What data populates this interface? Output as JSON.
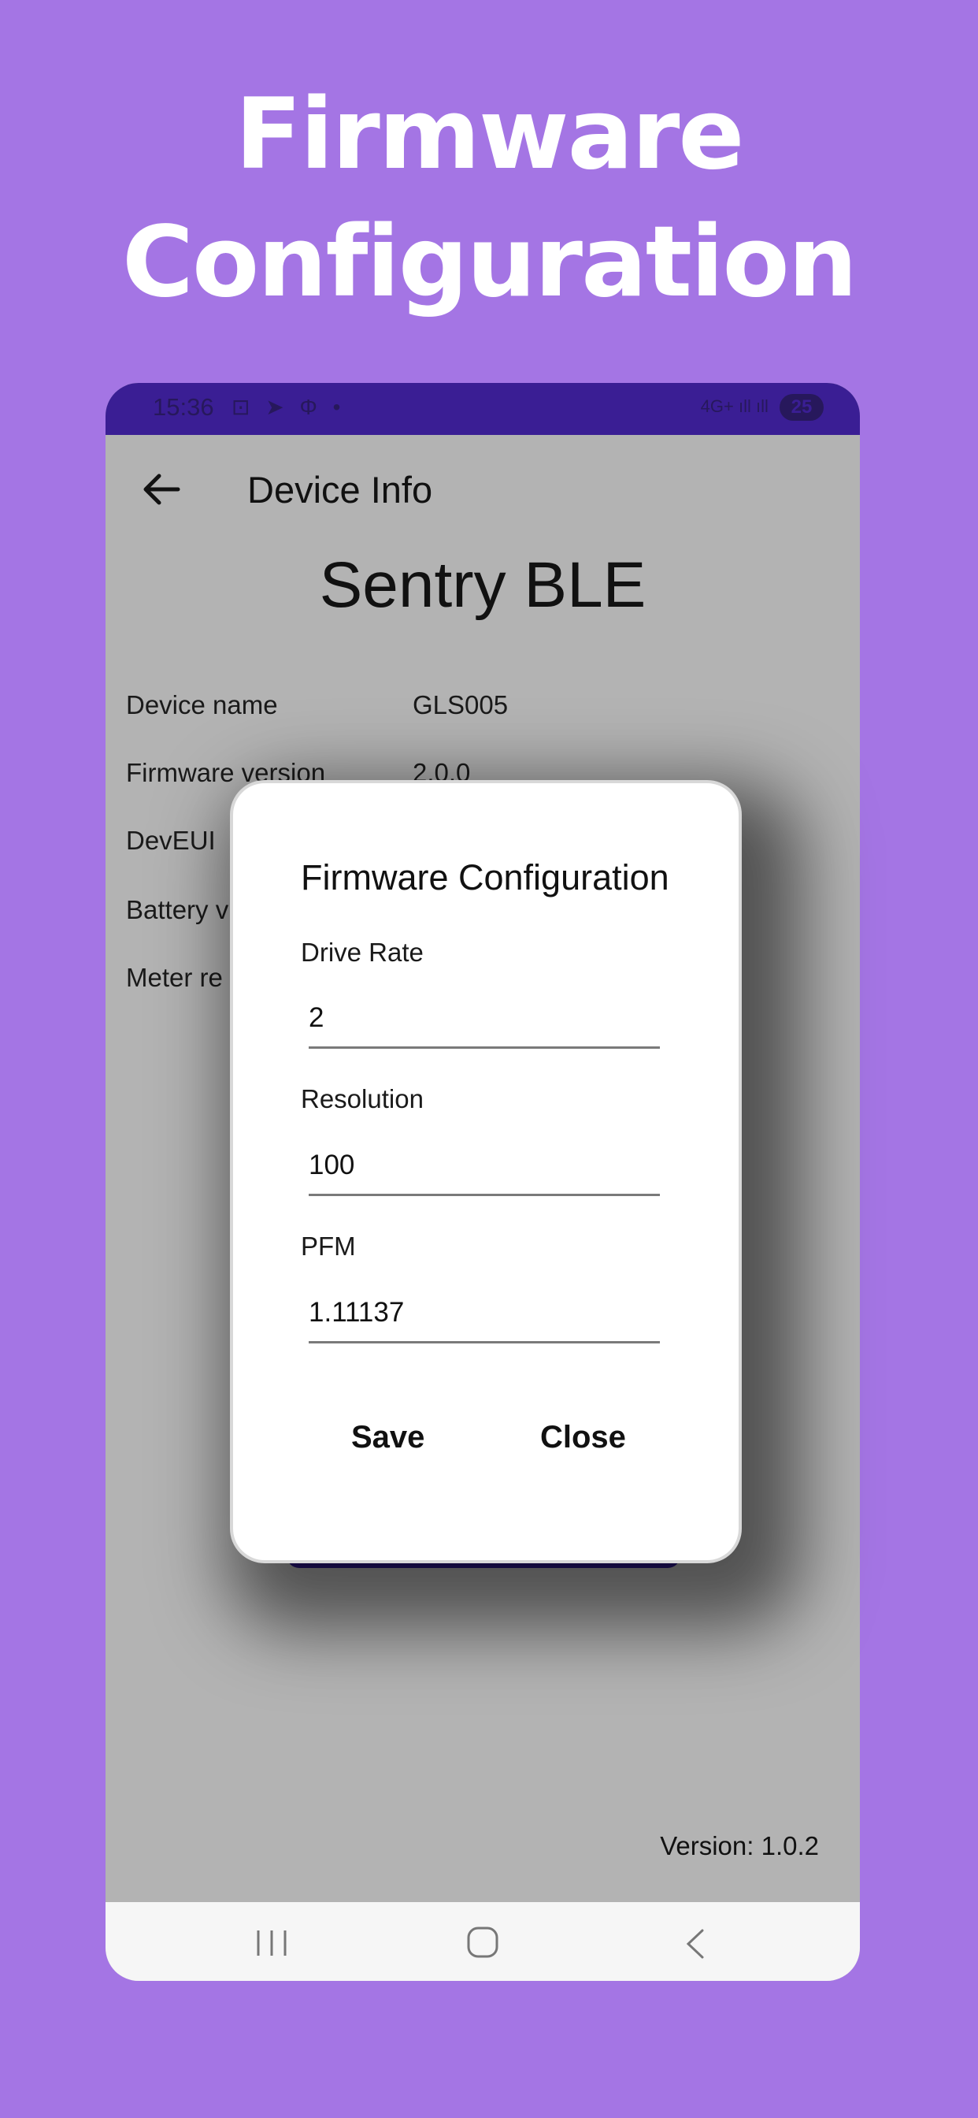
{
  "promo": {
    "title_line1": "Firmware",
    "title_line2": "Configuration"
  },
  "statusbar": {
    "time": "15:36",
    "icons_left": "⊡ ➤ Φ •",
    "network": "4G+ ıll ıll",
    "battery": "25"
  },
  "appbar": {
    "title": "Device Info"
  },
  "device": {
    "title": "Sentry BLE",
    "rows": [
      {
        "label": "Device name",
        "value": "GLS005"
      },
      {
        "label": "Firmware version",
        "value": "2.0.0"
      },
      {
        "label": "DevEUI",
        "value": ""
      },
      {
        "label": "Battery v",
        "value": ""
      },
      {
        "label": "Meter re",
        "value": ""
      }
    ]
  },
  "dialog": {
    "title": "Firmware Configuration",
    "fields": [
      {
        "label": "Drive Rate",
        "value": "2"
      },
      {
        "label": "Resolution",
        "value": "100"
      },
      {
        "label": "PFM",
        "value": "1.11137"
      }
    ],
    "save_label": "Save",
    "close_label": "Close"
  },
  "footer": {
    "version": "Version: 1.0.2"
  },
  "colors": {
    "background": "#a475e4",
    "statusbar": "#3a1e94",
    "overlay": "#b3b3b3"
  }
}
